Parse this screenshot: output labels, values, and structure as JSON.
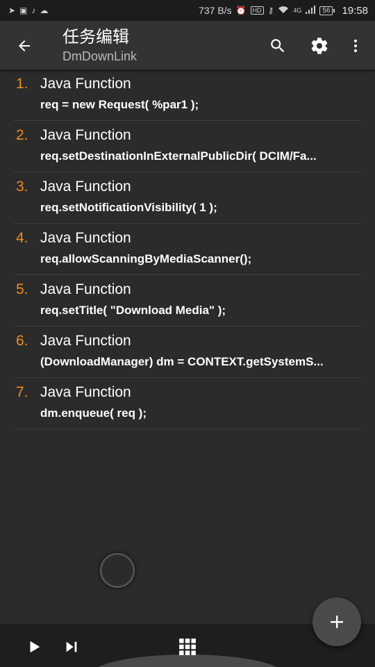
{
  "status_bar": {
    "network_speed": "737 B/s",
    "time": "19:58",
    "battery": "56",
    "hd_badge": "HD",
    "net_type": "4G",
    "left_icons": [
      "send-icon",
      "image-icon",
      "tiktok-icon",
      "wechat-icon"
    ],
    "right_icons": [
      "alarm-icon",
      "key-icon",
      "wifi-icon",
      "signal-icon"
    ]
  },
  "app_bar": {
    "title": "任务编辑",
    "subtitle": "DmDownLink",
    "icons": [
      "back-arrow-icon",
      "search-icon",
      "gear-icon",
      "more-vert-icon"
    ]
  },
  "actions": [
    {
      "num": "1.",
      "name": "Java Function",
      "code": "req = new Request( %par1 );"
    },
    {
      "num": "2.",
      "name": "Java Function",
      "code": "req.setDestinationInExternalPublicDir( DCIM/Fa..."
    },
    {
      "num": "3.",
      "name": "Java Function",
      "code": "req.setNotificationVisibility( 1 );"
    },
    {
      "num": "4.",
      "name": "Java Function",
      "code": "req.allowScanningByMediaScanner();"
    },
    {
      "num": "5.",
      "name": "Java Function",
      "code": "req.setTitle( \"Download Media\" );"
    },
    {
      "num": "6.",
      "name": "Java Function",
      "code": "(DownloadManager) dm = CONTEXT.getSystemS..."
    },
    {
      "num": "7.",
      "name": "Java Function",
      "code": "dm.enqueue( req );"
    }
  ],
  "fab": {
    "icon": "plus-icon"
  },
  "bottom_bar": {
    "icons": [
      "play-icon",
      "skip-next-icon",
      "grid-icon"
    ]
  },
  "colors": {
    "accent_number": "#f08b1c",
    "background": "#2b2b2b",
    "app_bar": "#333333"
  }
}
